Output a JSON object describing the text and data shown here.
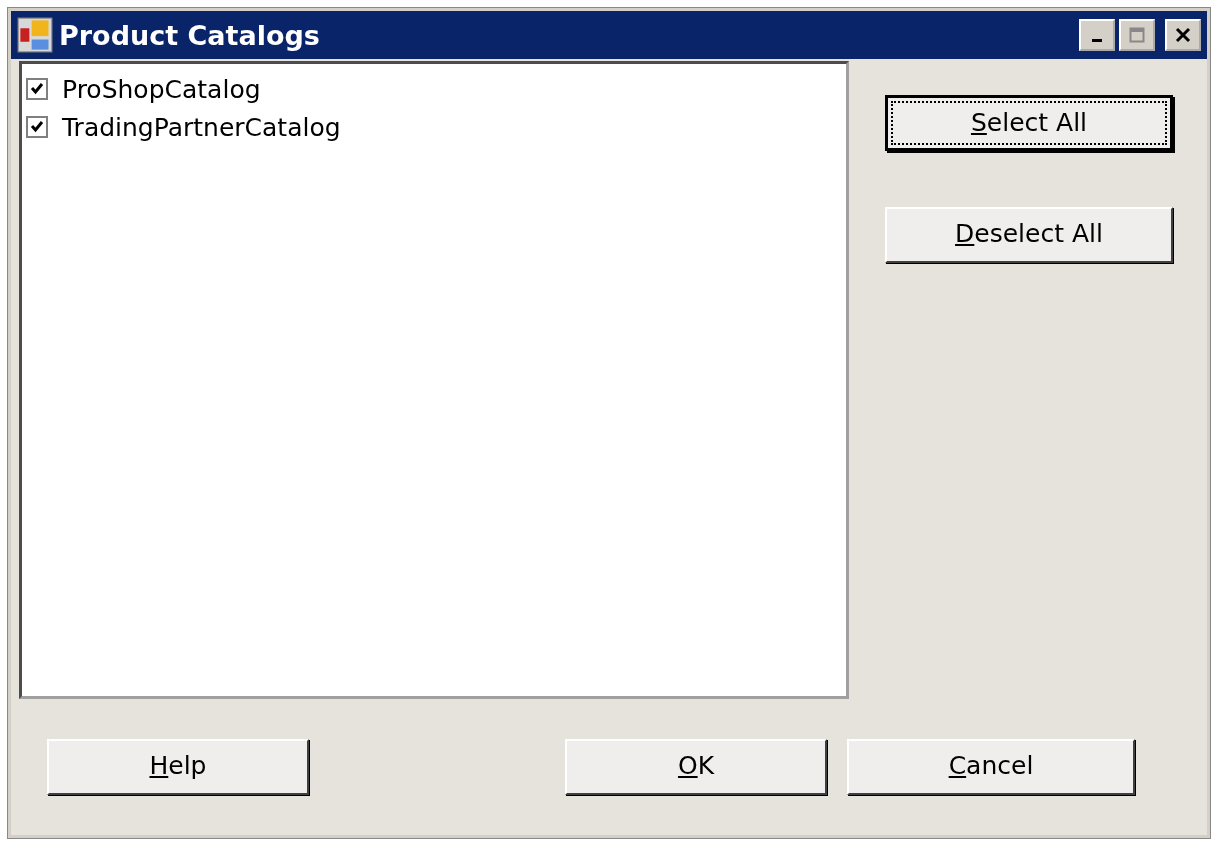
{
  "window": {
    "title": "Product Catalogs"
  },
  "catalogs": [
    {
      "label": "ProShopCatalog",
      "checked": true
    },
    {
      "label": "TradingPartnerCatalog",
      "checked": true
    }
  ],
  "side_buttons": [
    {
      "label": "Select All",
      "focused": true
    },
    {
      "label": "Deselect All",
      "focused": false
    }
  ],
  "bottom_buttons": [
    {
      "label": "Help",
      "focused": false
    },
    {
      "label": "OK",
      "focused": false
    },
    {
      "label": "Cancel",
      "focused": false
    }
  ]
}
